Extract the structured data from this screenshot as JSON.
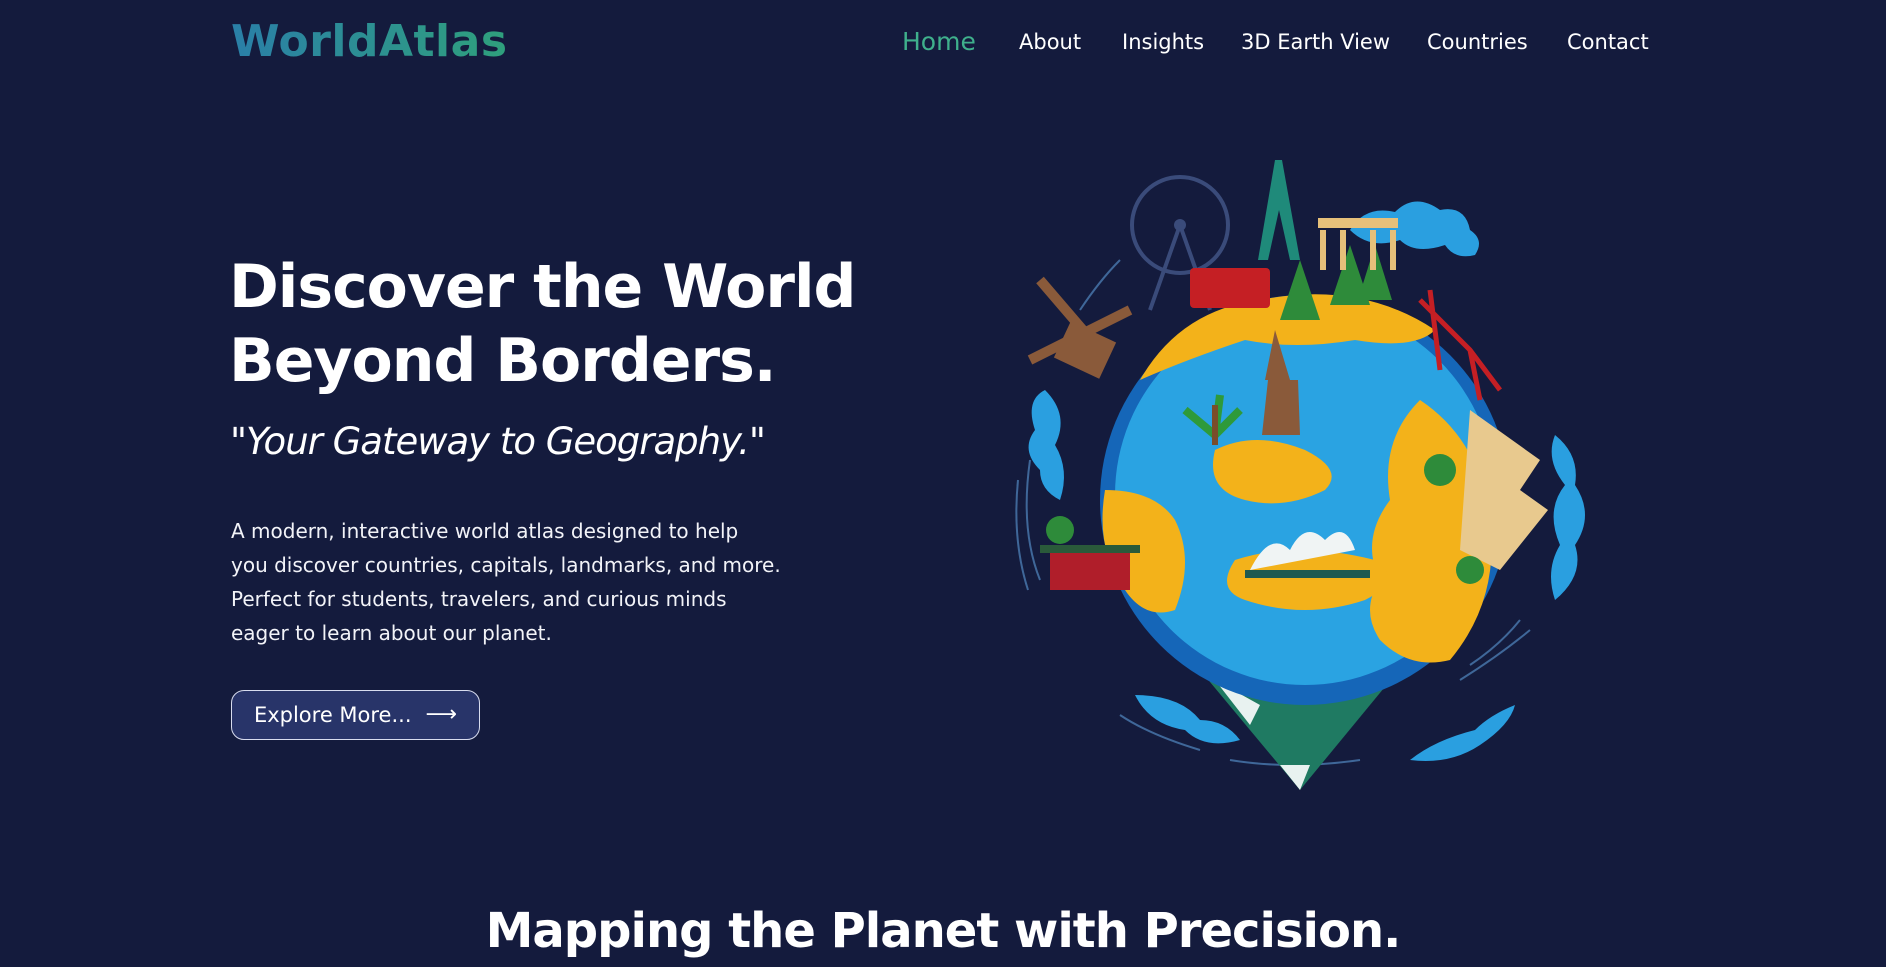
{
  "brand": {
    "logo_text": "WorldAtlas"
  },
  "nav": {
    "items": [
      {
        "label": "Home",
        "active": true
      },
      {
        "label": "About"
      },
      {
        "label": "Insights"
      },
      {
        "label": "3D Earth View"
      },
      {
        "label": "Countries"
      },
      {
        "label": "Contact"
      }
    ]
  },
  "hero": {
    "title_line1": "Discover the World",
    "title_line2": "Beyond Borders.",
    "tagline": "\"Your Gateway to Geography.\"",
    "description_lines": [
      "A modern, interactive world atlas designed to help",
      "you discover countries, capitals, landmarks, and more.",
      "Perfect for students, travelers, and curious minds",
      "eager to learn about our planet."
    ],
    "cta_label": "Explore More...",
    "cta_icon": "arrow-right-icon"
  },
  "section": {
    "title": "Mapping the Planet with Precision."
  },
  "colors": {
    "background": "#141b3d",
    "accent": "#3fb08c",
    "button_bg": "#283469"
  }
}
